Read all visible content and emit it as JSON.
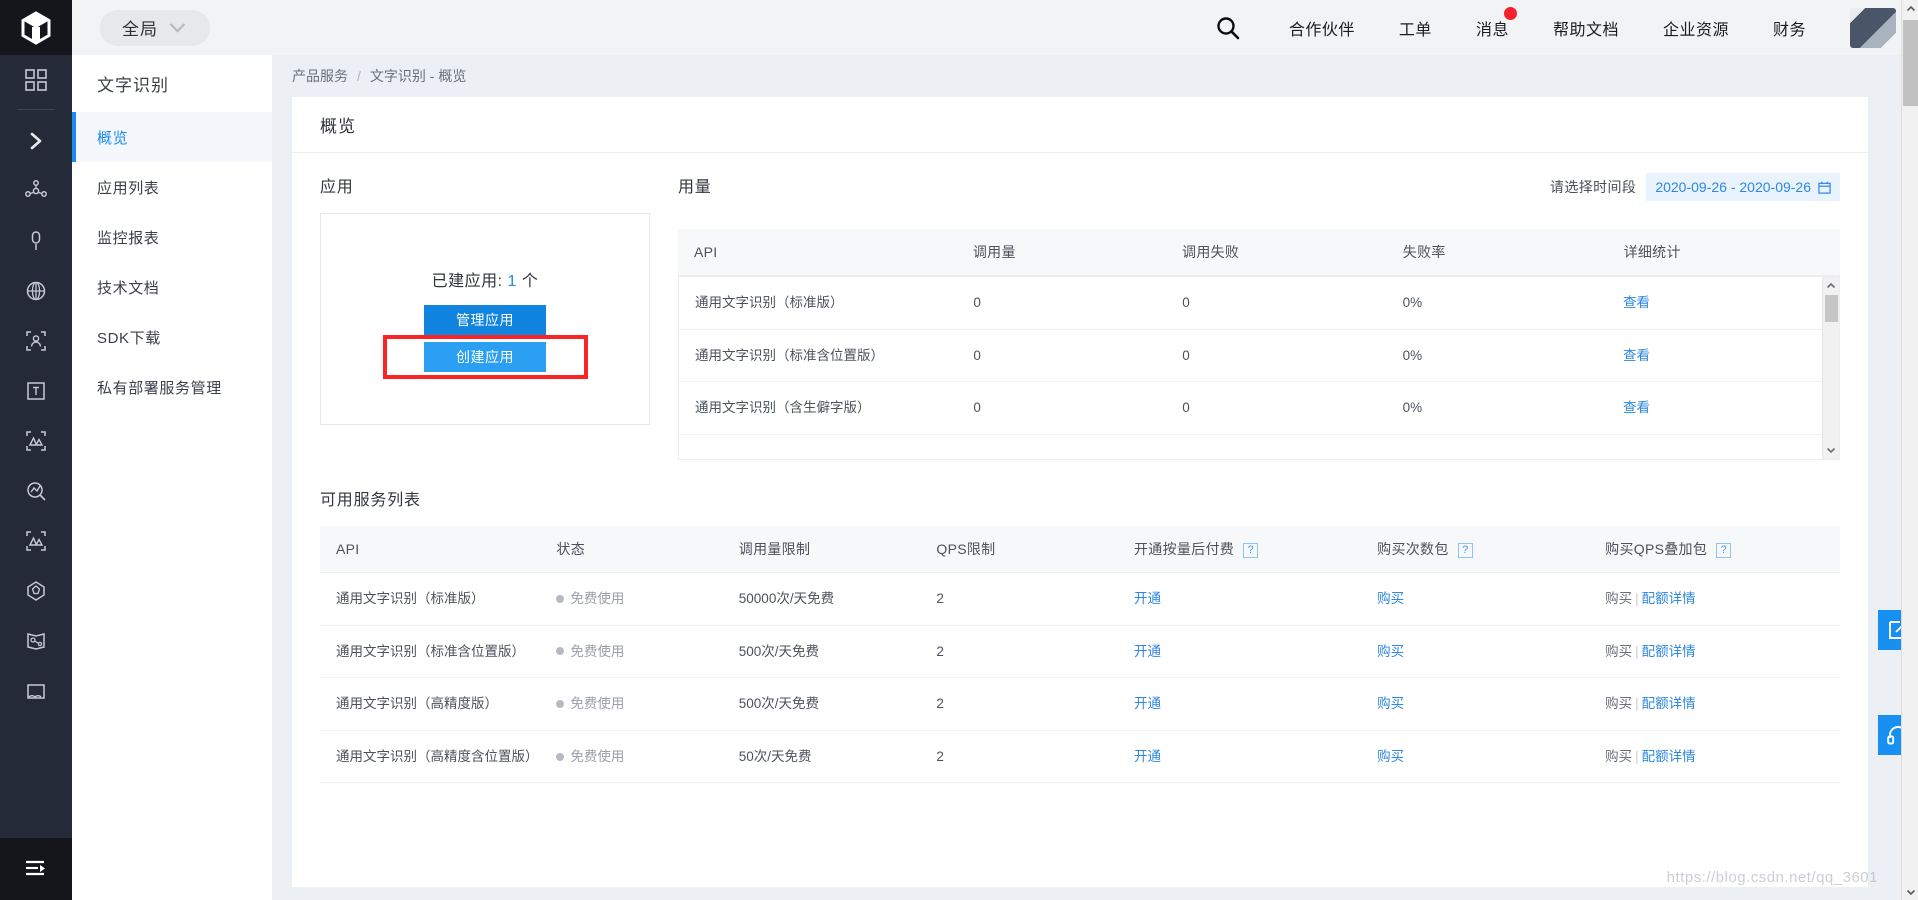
{
  "header": {
    "logo_name": "cube-logo",
    "scope_label": "全局",
    "search_icon": "search-icon",
    "nav": [
      {
        "label": "合作伙伴",
        "badge": false
      },
      {
        "label": "工单",
        "badge": false
      },
      {
        "label": "消息",
        "badge": true
      },
      {
        "label": "帮助文档",
        "badge": false
      },
      {
        "label": "企业资源",
        "badge": false
      },
      {
        "label": "财务",
        "badge": false
      }
    ]
  },
  "rail": {
    "items": [
      {
        "icon": "grid-apps-icon"
      },
      {
        "icon": "chevron-right-expand-icon"
      },
      {
        "icon": "nodes-network-icon"
      },
      {
        "icon": "microphone-icon"
      },
      {
        "icon": "globe-icon"
      },
      {
        "icon": "face-scan-icon"
      },
      {
        "icon": "text-box-icon"
      },
      {
        "icon": "image-recognition-icon"
      },
      {
        "icon": "analytics-search-icon"
      },
      {
        "icon": "image-scan-icon"
      },
      {
        "icon": "gem-shield-icon"
      },
      {
        "icon": "map-graph-icon"
      },
      {
        "icon": "picture-icon"
      }
    ],
    "bottom_icon": "collapse-menu-icon"
  },
  "sidebar": {
    "title": "文字识别",
    "items": [
      {
        "label": "概览",
        "active": true
      },
      {
        "label": "应用列表",
        "active": false
      },
      {
        "label": "监控报表",
        "active": false
      },
      {
        "label": "技术文档",
        "active": false
      },
      {
        "label": "SDK下载",
        "active": false
      },
      {
        "label": "私有部署服务管理",
        "active": false
      }
    ]
  },
  "breadcrumb": {
    "root": "产品服务",
    "separator": "/",
    "current": "文字识别 - 概览"
  },
  "panel": {
    "title": "概览"
  },
  "app_section": {
    "title": "应用",
    "count_label": "已建应用:",
    "count_value": "1",
    "count_unit": "个",
    "manage_button": "管理应用",
    "create_button": "创建应用",
    "highlight_color": "#fb2323"
  },
  "usage_section": {
    "title": "用量",
    "date_label": "请选择时间段",
    "date_value": "2020-09-26 - 2020-09-26",
    "calendar_icon": "calendar-icon",
    "columns": [
      "API",
      "调用量",
      "调用失败",
      "失败率",
      "详细统计"
    ],
    "rows": [
      {
        "api": "通用文字识别（标准版）",
        "calls": "0",
        "failed": "0",
        "fail_rate": "0%",
        "detail": "查看"
      },
      {
        "api": "通用文字识别（标准含位置版）",
        "calls": "0",
        "failed": "0",
        "fail_rate": "0%",
        "detail": "查看"
      },
      {
        "api": "通用文字识别（含生僻字版）",
        "calls": "0",
        "failed": "0",
        "fail_rate": "0%",
        "detail": "查看"
      }
    ]
  },
  "services_section": {
    "title": "可用服务列表",
    "columns": [
      {
        "label": "API",
        "help": false
      },
      {
        "label": "状态",
        "help": false
      },
      {
        "label": "调用量限制",
        "help": false
      },
      {
        "label": "QPS限制",
        "help": false
      },
      {
        "label": "开通按量后付费",
        "help": true
      },
      {
        "label": "购买次数包",
        "help": true
      },
      {
        "label": "购买QPS叠加包",
        "help": true
      }
    ],
    "help_glyph": "?",
    "rows": [
      {
        "api": "通用文字识别（标准版）",
        "status": "免费使用",
        "limit": "50000次/天免费",
        "qps": "2",
        "postpaid": "开通",
        "package": "购买",
        "qps_pack_buy": "购买",
        "qps_pack_detail": "配额详情"
      },
      {
        "api": "通用文字识别（标准含位置版）",
        "status": "免费使用",
        "limit": "500次/天免费",
        "qps": "2",
        "postpaid": "开通",
        "package": "购买",
        "qps_pack_buy": "购买",
        "qps_pack_detail": "配额详情"
      },
      {
        "api": "通用文字识别（高精度版）",
        "status": "免费使用",
        "limit": "500次/天免费",
        "qps": "2",
        "postpaid": "开通",
        "package": "购买",
        "qps_pack_buy": "购买",
        "qps_pack_detail": "配额详情"
      },
      {
        "api": "通用文字识别（高精度含位置版）",
        "status": "免费使用",
        "limit": "50次/天免费",
        "qps": "2",
        "postpaid": "开通",
        "package": "购买",
        "qps_pack_buy": "购买",
        "qps_pack_detail": "配额详情"
      }
    ]
  },
  "floating": {
    "edit_icon": "edit-feedback-icon",
    "help_icon": "headset-support-icon"
  },
  "watermark": "https://blog.csdn.net/qq_3601"
}
